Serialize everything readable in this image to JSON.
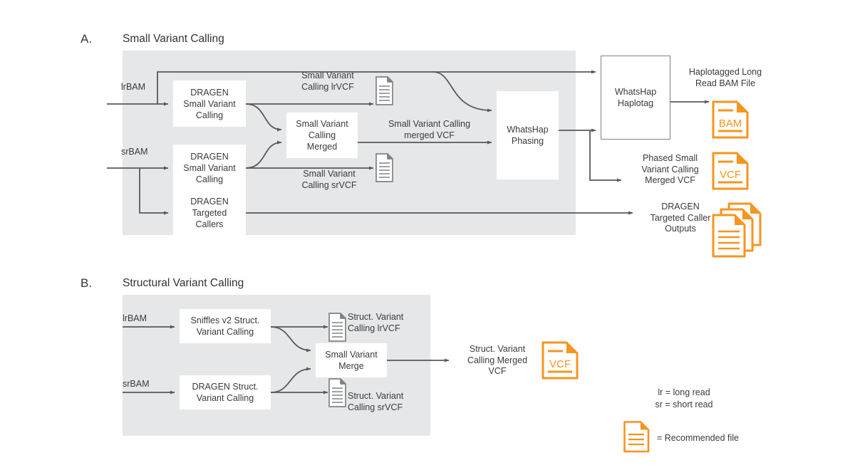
{
  "panels": [
    {
      "letter": "A.",
      "title": "Small Variant Calling"
    },
    {
      "letter": "B.",
      "title": "Structural Variant Calling"
    }
  ],
  "panel_a": {
    "inputs": [
      {
        "label": "lrBAM"
      },
      {
        "label": "srBAM"
      }
    ],
    "processes": [
      {
        "label": "DRAGEN\nSmall Variant\nCalling"
      },
      {
        "label": "DRAGEN\nSmall Variant\nCalling"
      },
      {
        "label": "DRAGEN\nTargeted\nCallers"
      },
      {
        "label": "Small Variant\nCalling\nMerged"
      },
      {
        "label": "WhatsHap\nPhasing"
      },
      {
        "label": "WhatsHap\nHaplotag"
      }
    ],
    "edge_labels": [
      {
        "label": "Small Variant\nCalling lrVCF"
      },
      {
        "label": "Small Variant\nCalling srVCF"
      },
      {
        "label": "Small Variant Calling\nmerged VCF"
      }
    ],
    "outputs": [
      {
        "label": "Haplotagged Long\nRead BAM File",
        "file": "BAM"
      },
      {
        "label": "Phased Small\nVariant Calling\nMerged VCF",
        "file": "VCF"
      },
      {
        "label": "DRAGEN\nTargeted Caller\nOutputs",
        "file": "stack"
      }
    ]
  },
  "panel_b": {
    "inputs": [
      {
        "label": "lrBAM"
      },
      {
        "label": "srBAM"
      }
    ],
    "processes": [
      {
        "label": "Sniffles v2 Struct.\nVariant Calling"
      },
      {
        "label": "DRAGEN Struct.\nVariant Calling"
      },
      {
        "label": "Small Variant\nMerge"
      }
    ],
    "doc_labels": [
      {
        "label": "Struct. Variant\nCalling lrVCF"
      },
      {
        "label": "Struct. Variant\nCalling srVCF"
      }
    ],
    "outputs": [
      {
        "label": "Struct. Variant\nCalling Merged\nVCF",
        "file": "VCF"
      }
    ]
  },
  "legend": {
    "abbreviations": "lr = long read\nsr = short read",
    "recommended": "= Recommended file"
  },
  "colors": {
    "orange": "#F7941E",
    "panel_gray": "#e6e7e8",
    "line_gray": "#58595b",
    "doc_gray": "#808285",
    "text": "#3b3b3b"
  },
  "icons": {
    "document": "document-icon",
    "document_stack": "document-stack-icon",
    "bam_file": "bam-file-icon",
    "vcf_file": "vcf-file-icon"
  }
}
